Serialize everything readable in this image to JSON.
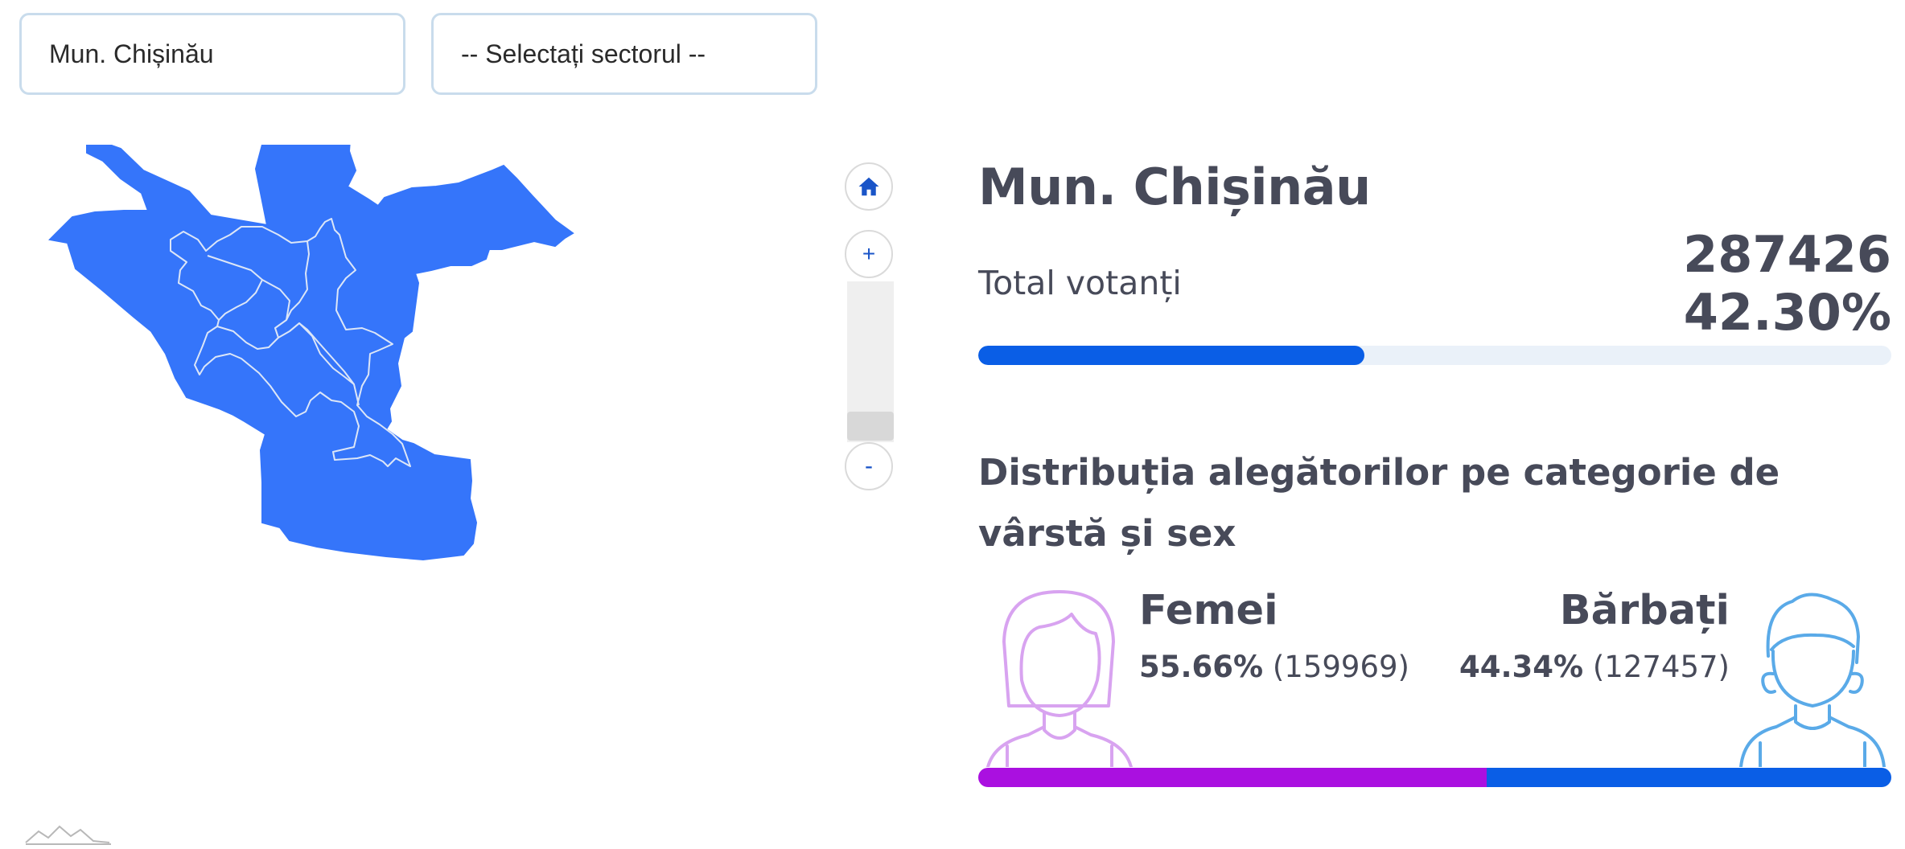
{
  "filters": {
    "city_select": "Mun. Chișinău",
    "sector_select": "-- Selectați sectorul --"
  },
  "map": {
    "region_color": "#3575fa",
    "border_color": "#dce6f7",
    "controls": {
      "zoom_in_label": "+",
      "zoom_out_label": "-",
      "home_icon": "home-icon"
    }
  },
  "panel": {
    "title": "Mun. Chișinău",
    "total_label": "Total votanți",
    "total_count": "287426",
    "total_percent": "42.30%",
    "turnout_fraction": 0.423,
    "distribution_heading": "Distribuția alegătorilor pe categorie de vârstă și sex",
    "female": {
      "label": "Femei",
      "percent": "55.66%",
      "count": "(159969)",
      "share": 0.5566,
      "color": "#aa10e0"
    },
    "male": {
      "label": "Bărbați",
      "percent": "44.34%",
      "count": "(127457)",
      "share": 0.4434,
      "color": "#0a5ee6"
    }
  }
}
